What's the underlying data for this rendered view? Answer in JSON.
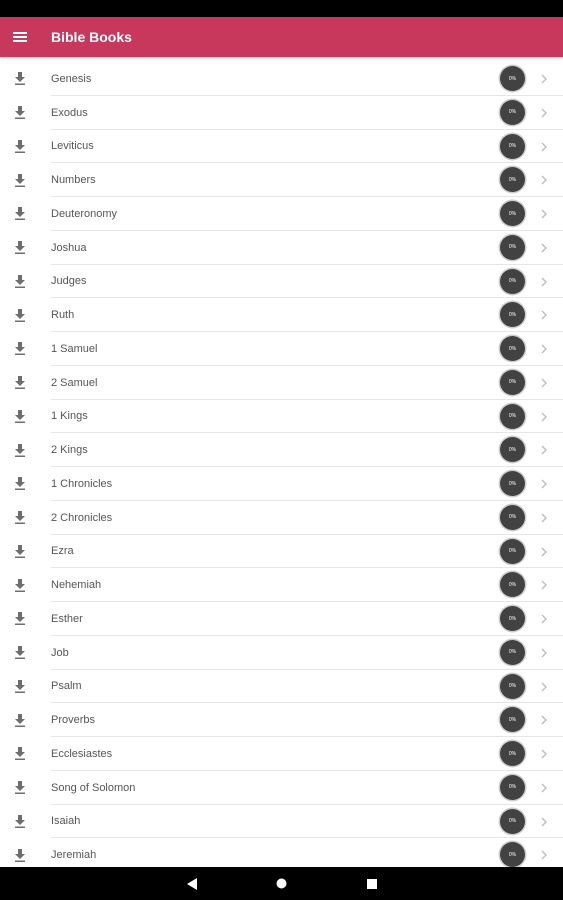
{
  "app_bar": {
    "title": "Bible Books",
    "background": "#c8375c",
    "menu_icon": "hamburger-menu-icon"
  },
  "books": [
    {
      "name": "Genesis",
      "progress": "0%"
    },
    {
      "name": "Exodus",
      "progress": "0%"
    },
    {
      "name": "Leviticus",
      "progress": "0%"
    },
    {
      "name": "Numbers",
      "progress": "0%"
    },
    {
      "name": "Deuteronomy",
      "progress": "0%"
    },
    {
      "name": "Joshua",
      "progress": "0%"
    },
    {
      "name": "Judges",
      "progress": "0%"
    },
    {
      "name": "Ruth",
      "progress": "0%"
    },
    {
      "name": "1 Samuel",
      "progress": "0%"
    },
    {
      "name": "2 Samuel",
      "progress": "0%"
    },
    {
      "name": "1 Kings",
      "progress": "0%"
    },
    {
      "name": "2 Kings",
      "progress": "0%"
    },
    {
      "name": "1 Chronicles",
      "progress": "0%"
    },
    {
      "name": "2 Chronicles",
      "progress": "0%"
    },
    {
      "name": "Ezra",
      "progress": "0%"
    },
    {
      "name": "Nehemiah",
      "progress": "0%"
    },
    {
      "name": "Esther",
      "progress": "0%"
    },
    {
      "name": "Job",
      "progress": "0%"
    },
    {
      "name": "Psalm",
      "progress": "0%"
    },
    {
      "name": "Proverbs",
      "progress": "0%"
    },
    {
      "name": "Ecclesiastes",
      "progress": "0%"
    },
    {
      "name": "Song of Solomon",
      "progress": "0%"
    },
    {
      "name": "Isaiah",
      "progress": "0%"
    },
    {
      "name": "Jeremiah",
      "progress": "0%"
    }
  ],
  "row_icons": {
    "download": "download-icon",
    "chevron": "chevron-right-icon"
  },
  "nav_bar": {
    "buttons": [
      "back-icon",
      "home-icon",
      "recents-icon"
    ]
  }
}
